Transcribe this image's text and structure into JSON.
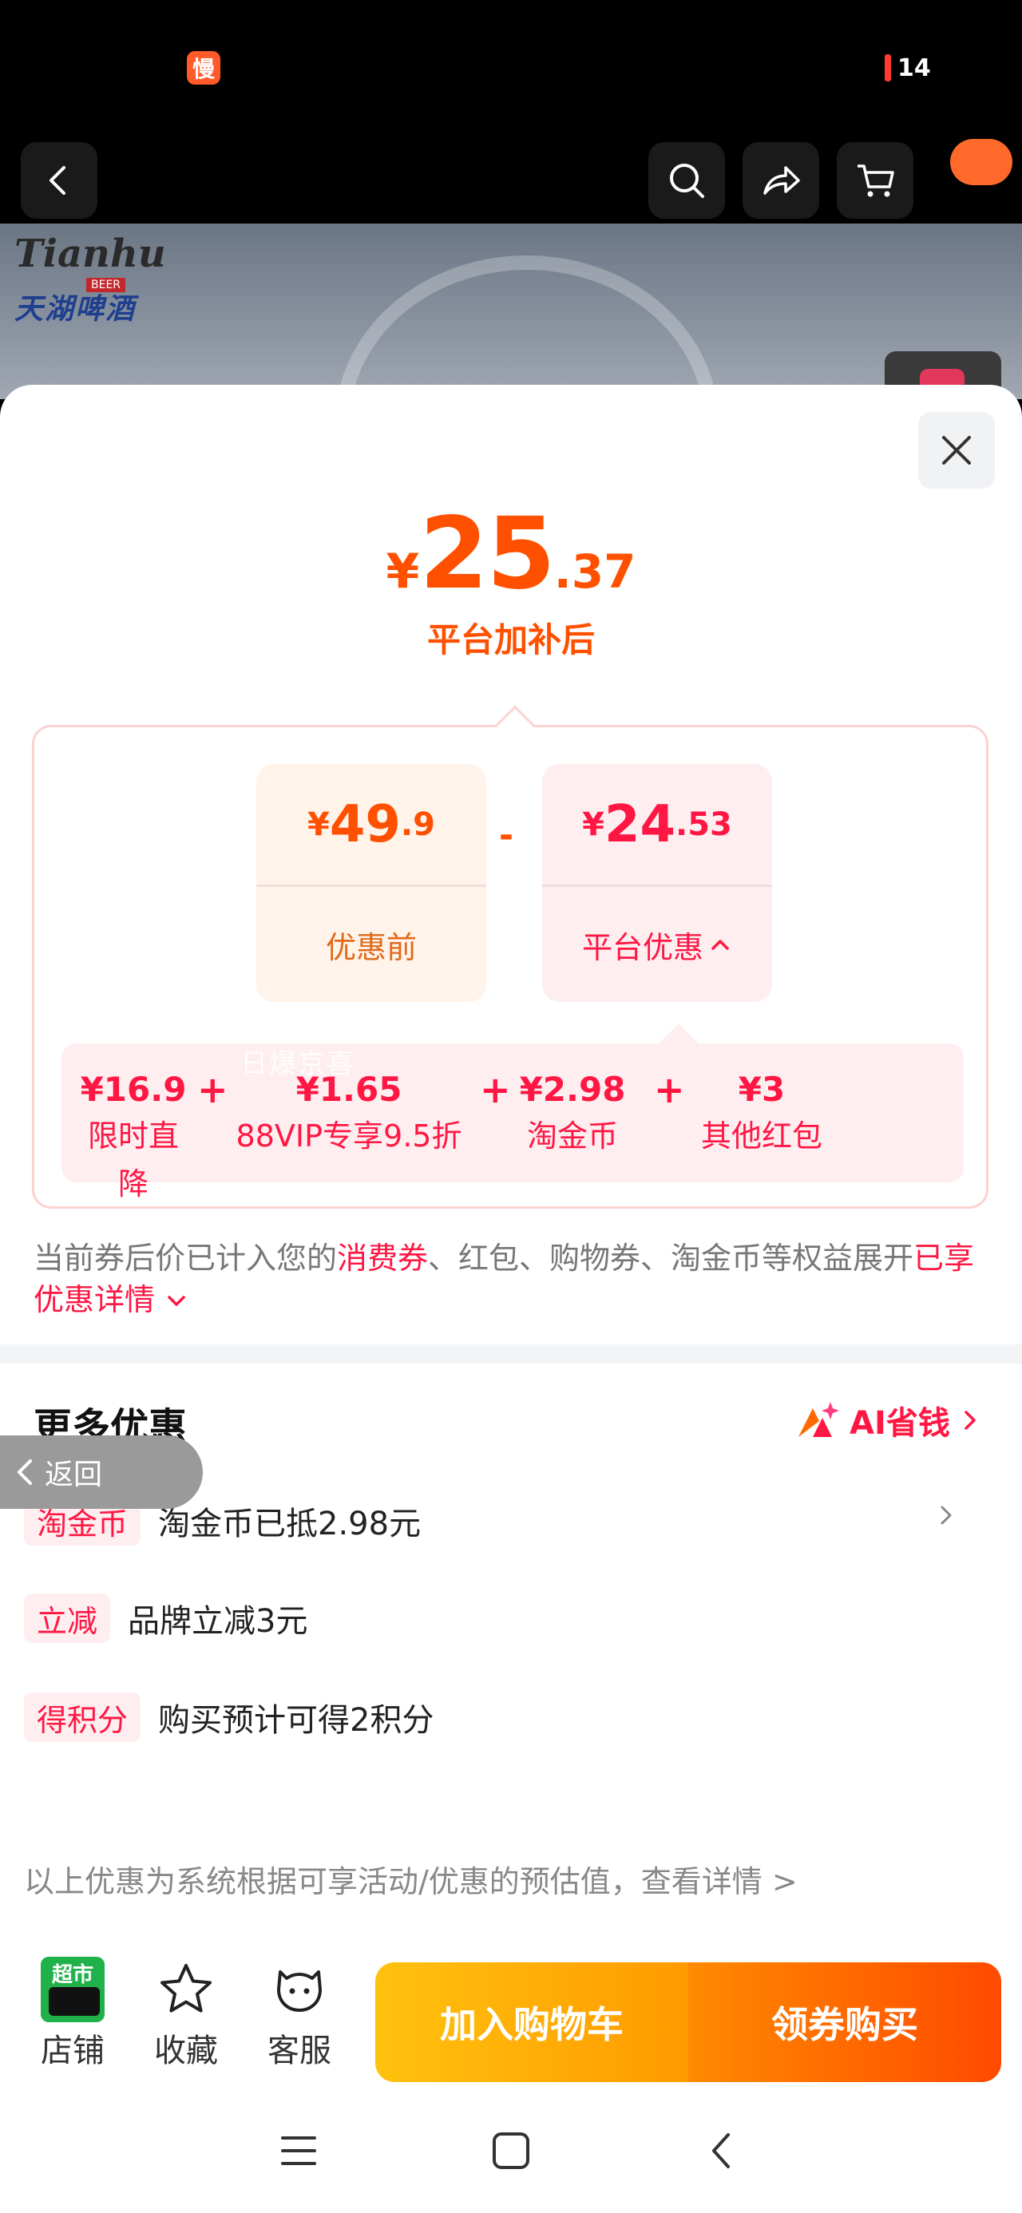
{
  "status": {
    "app_badge": "慢",
    "battery": "14"
  },
  "brand": {
    "en": "Tianhu",
    "beer": "BEER",
    "cn": "天湖啤酒"
  },
  "sheet": {
    "final_price": {
      "symbol": "¥",
      "integer": "25",
      "decimal": ".37"
    },
    "final_caption": "平台加补后",
    "before": {
      "symbol": "¥",
      "integer": "49",
      "decimal": ".9",
      "label": "优惠前"
    },
    "operator": "-",
    "discount": {
      "symbol": "¥",
      "integer": "24",
      "decimal": ".53",
      "label": "平台优惠"
    },
    "details": [
      {
        "value": "¥16.9",
        "label": "限时直降"
      },
      {
        "value": "¥1.65",
        "label": "88VIP专享9.5折"
      },
      {
        "value": "¥2.98",
        "label": "淘金币"
      },
      {
        "value": "¥3",
        "label": "其他红包"
      }
    ],
    "plus": "+",
    "watermark": "日爆京喜",
    "notice": {
      "part1": "当前券后价已计入您的",
      "highlight1": "消费券",
      "part2": "、红包、购物券、淘金币等权益展开",
      "highlight2": "已享优惠详情"
    },
    "more_title": "更多优惠",
    "ai_save": "AI省钱",
    "back_label": "返回",
    "promos": [
      {
        "tag": "淘金币",
        "text": "淘金币已抵2.98元"
      },
      {
        "tag": "立减",
        "text": "品牌立减3元"
      },
      {
        "tag": "得积分",
        "text": "购买预计可得2积分"
      }
    ],
    "estimate_note": "以上优惠为系统根据可享活动/优惠的预估值，查看详情 >"
  },
  "actions": {
    "shop_badge": "超市",
    "shop": "店铺",
    "favorite": "收藏",
    "service": "客服",
    "add_cart": "加入购物车",
    "buy": "领券购买"
  },
  "colors": {
    "accent_orange": "#ff5000",
    "accent_red": "#ff1744",
    "tmall_green": "#21b14a"
  }
}
